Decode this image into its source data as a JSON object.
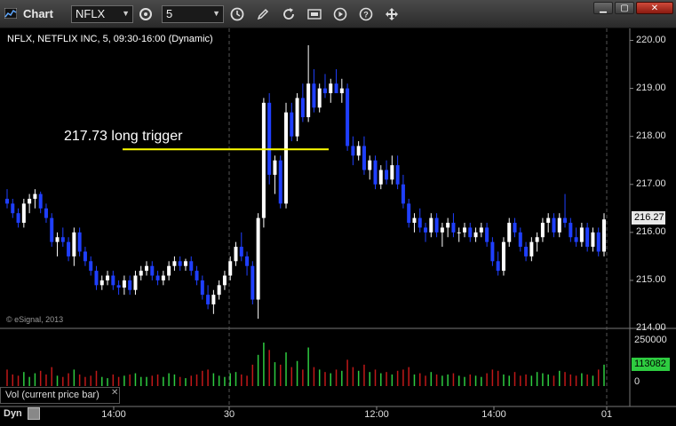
{
  "window": {
    "title": "Chart",
    "symbol": "NFLX",
    "interval": "5"
  },
  "toolbar": {
    "icons": [
      "symbol-link-icon",
      "clock-icon",
      "pencil-icon",
      "refresh-icon",
      "quote-icon",
      "play-icon",
      "help-icon",
      "cursor-move-icon"
    ]
  },
  "chart": {
    "header": "NFLX, NETFLIX INC, 5, 09:30-16:00 (Dynamic)",
    "copyright": "© eSignal, 2013",
    "annotation": "217.73 long trigger",
    "trigger_price": 217.73,
    "last_price_tag": "216.27",
    "price_ticks": [
      "220.00",
      "219.00",
      "218.00",
      "217.00",
      "216.00",
      "215.00",
      "214.00"
    ],
    "time_ticks": [
      "14:00",
      "30",
      "12:00",
      "14:00",
      "01"
    ],
    "volume_ticks": [
      "250000",
      "0"
    ],
    "volume_tag": "113082",
    "volume_label": "Vol (current price bar)",
    "dyn_label": "Dyn",
    "colors": {
      "up": "#ffffff",
      "down": "#1f3fff",
      "trigger": "#ffff00",
      "vol_up": "#2ecc40",
      "vol_down": "#c01818"
    }
  },
  "chart_data": {
    "type": "candlestick",
    "ylim": [
      214.0,
      220.25
    ],
    "volume_max": 300000,
    "candles": [
      [
        216.7,
        216.9,
        216.5,
        216.6
      ],
      [
        216.6,
        216.7,
        216.3,
        216.4
      ],
      [
        216.4,
        216.5,
        216.1,
        216.2
      ],
      [
        216.2,
        216.7,
        216.1,
        216.6
      ],
      [
        216.6,
        216.8,
        216.4,
        216.7
      ],
      [
        216.7,
        216.9,
        216.5,
        216.8
      ],
      [
        216.8,
        216.85,
        216.4,
        216.5
      ],
      [
        216.5,
        216.6,
        216.2,
        216.3
      ],
      [
        216.3,
        216.4,
        215.7,
        215.8
      ],
      [
        215.8,
        216.0,
        215.5,
        215.9
      ],
      [
        215.9,
        216.1,
        215.7,
        215.8
      ],
      [
        215.8,
        215.9,
        215.4,
        215.5
      ],
      [
        215.5,
        216.1,
        215.3,
        216.0
      ],
      [
        216.0,
        216.1,
        215.5,
        215.6
      ],
      [
        215.6,
        215.7,
        215.3,
        215.4
      ],
      [
        215.4,
        215.5,
        215.1,
        215.2
      ],
      [
        215.2,
        215.3,
        214.8,
        214.9
      ],
      [
        214.9,
        215.1,
        214.8,
        215.0
      ],
      [
        215.0,
        215.2,
        214.9,
        215.1
      ],
      [
        215.1,
        215.2,
        214.8,
        214.9
      ],
      [
        214.9,
        215.0,
        214.7,
        214.85
      ],
      [
        214.85,
        215.1,
        214.7,
        215.0
      ],
      [
        215.0,
        215.1,
        214.7,
        214.8
      ],
      [
        214.8,
        215.2,
        214.7,
        215.1
      ],
      [
        215.1,
        215.3,
        215.0,
        215.2
      ],
      [
        215.2,
        215.4,
        215.1,
        215.3
      ],
      [
        215.3,
        215.4,
        215.0,
        215.1
      ],
      [
        215.1,
        215.2,
        214.9,
        215.0
      ],
      [
        215.0,
        215.2,
        214.9,
        215.1
      ],
      [
        215.1,
        215.4,
        215.0,
        215.3
      ],
      [
        215.3,
        215.5,
        215.2,
        215.4
      ],
      [
        215.4,
        215.5,
        215.2,
        215.3
      ],
      [
        215.3,
        215.45,
        215.2,
        215.4
      ],
      [
        215.4,
        215.5,
        215.1,
        215.2
      ],
      [
        215.2,
        215.3,
        214.9,
        215.0
      ],
      [
        215.0,
        215.1,
        214.6,
        214.7
      ],
      [
        214.7,
        214.9,
        214.4,
        214.5
      ],
      [
        214.5,
        214.8,
        214.3,
        214.7
      ],
      [
        214.7,
        215.0,
        214.6,
        214.9
      ],
      [
        214.9,
        215.2,
        214.8,
        215.1
      ],
      [
        215.1,
        215.5,
        215.0,
        215.4
      ],
      [
        215.4,
        215.8,
        215.3,
        215.7
      ],
      [
        215.7,
        216.0,
        215.4,
        215.5
      ],
      [
        215.5,
        215.6,
        215.1,
        215.3
      ],
      [
        215.3,
        215.4,
        214.5,
        214.6
      ],
      [
        214.6,
        216.4,
        214.2,
        216.3
      ],
      [
        216.3,
        218.8,
        216.1,
        218.7
      ],
      [
        218.7,
        218.9,
        217.0,
        217.2
      ],
      [
        217.2,
        217.6,
        216.8,
        217.5
      ],
      [
        217.5,
        217.6,
        216.5,
        216.6
      ],
      [
        216.6,
        218.7,
        216.5,
        218.5
      ],
      [
        218.5,
        218.7,
        217.9,
        218.0
      ],
      [
        218.0,
        218.9,
        217.9,
        218.8
      ],
      [
        218.8,
        219.1,
        218.3,
        218.4
      ],
      [
        218.4,
        219.9,
        218.3,
        219.1
      ],
      [
        219.1,
        219.4,
        218.5,
        218.6
      ],
      [
        218.6,
        219.1,
        218.5,
        219.0
      ],
      [
        219.0,
        219.3,
        218.8,
        218.9
      ],
      [
        218.9,
        219.2,
        218.7,
        219.1
      ],
      [
        219.1,
        219.4,
        218.9,
        218.9
      ],
      [
        218.9,
        219.2,
        218.7,
        219.0
      ],
      [
        219.0,
        219.1,
        217.7,
        217.8
      ],
      [
        217.8,
        218.0,
        217.4,
        217.6
      ],
      [
        217.6,
        217.9,
        217.5,
        217.8
      ],
      [
        217.8,
        218.0,
        217.2,
        217.3
      ],
      [
        217.3,
        217.6,
        217.1,
        217.5
      ],
      [
        217.5,
        217.6,
        216.9,
        217.0
      ],
      [
        217.0,
        217.4,
        216.9,
        217.3
      ],
      [
        217.3,
        217.5,
        217.0,
        217.1
      ],
      [
        217.1,
        217.6,
        217.0,
        217.4
      ],
      [
        217.4,
        217.6,
        216.9,
        217.0
      ],
      [
        217.0,
        217.2,
        216.5,
        216.6
      ],
      [
        216.6,
        216.7,
        216.1,
        216.2
      ],
      [
        216.2,
        216.4,
        216.0,
        216.3
      ],
      [
        216.3,
        216.5,
        216.0,
        216.1
      ],
      [
        216.1,
        216.2,
        215.8,
        216.0
      ],
      [
        216.0,
        216.4,
        215.9,
        216.3
      ],
      [
        216.3,
        216.4,
        215.9,
        216.0
      ],
      [
        216.0,
        216.2,
        215.7,
        216.1
      ],
      [
        216.1,
        216.3,
        215.9,
        216.2
      ],
      [
        216.2,
        216.4,
        215.9,
        216.0
      ],
      [
        216.0,
        216.1,
        215.8,
        216.0
      ],
      [
        216.0,
        216.2,
        215.9,
        216.1
      ],
      [
        216.1,
        216.2,
        215.8,
        215.9
      ],
      [
        215.9,
        216.1,
        215.8,
        216.0
      ],
      [
        216.0,
        216.2,
        215.9,
        216.1
      ],
      [
        216.1,
        216.2,
        215.7,
        215.8
      ],
      [
        215.8,
        215.9,
        215.3,
        215.4
      ],
      [
        215.4,
        215.6,
        215.1,
        215.2
      ],
      [
        215.2,
        215.9,
        215.1,
        215.8
      ],
      [
        215.8,
        216.3,
        215.7,
        216.2
      ],
      [
        216.2,
        216.3,
        215.9,
        216.0
      ],
      [
        216.0,
        216.1,
        215.6,
        215.7
      ],
      [
        215.7,
        215.8,
        215.4,
        215.5
      ],
      [
        215.5,
        215.9,
        215.4,
        215.8
      ],
      [
        215.8,
        216.0,
        215.6,
        215.9
      ],
      [
        215.9,
        216.3,
        215.8,
        216.2
      ],
      [
        216.2,
        216.4,
        216.0,
        216.3
      ],
      [
        216.3,
        216.4,
        215.9,
        216.0
      ],
      [
        216.0,
        216.4,
        215.9,
        216.3
      ],
      [
        216.3,
        216.8,
        216.1,
        216.2
      ],
      [
        216.2,
        216.3,
        215.8,
        215.9
      ],
      [
        215.9,
        216.1,
        215.7,
        215.8
      ],
      [
        215.8,
        216.2,
        215.7,
        216.1
      ],
      [
        216.1,
        216.2,
        215.6,
        215.7
      ],
      [
        215.7,
        216.1,
        215.6,
        216.0
      ],
      [
        216.0,
        216.1,
        215.5,
        215.6
      ],
      [
        215.6,
        216.4,
        215.5,
        216.27
      ]
    ],
    "volume": [
      60,
      40,
      35,
      50,
      30,
      45,
      55,
      40,
      70,
      35,
      30,
      45,
      60,
      40,
      30,
      35,
      55,
      30,
      25,
      40,
      30,
      35,
      40,
      45,
      30,
      30,
      35,
      40,
      30,
      45,
      40,
      30,
      25,
      35,
      40,
      55,
      60,
      45,
      35,
      30,
      45,
      50,
      40,
      35,
      80,
      120,
      170,
      140,
      90,
      80,
      130,
      70,
      95,
      60,
      150,
      70,
      60,
      50,
      45,
      60,
      55,
      100,
      70,
      55,
      80,
      50,
      60,
      45,
      50,
      40,
      55,
      60,
      70,
      40,
      45,
      35,
      50,
      40,
      35,
      40,
      45,
      35,
      30,
      40,
      35,
      30,
      45,
      60,
      55,
      40,
      35,
      50,
      35,
      40,
      35,
      50,
      45,
      40,
      35,
      55,
      50,
      40,
      35,
      45,
      40,
      35,
      60,
      80
    ]
  }
}
